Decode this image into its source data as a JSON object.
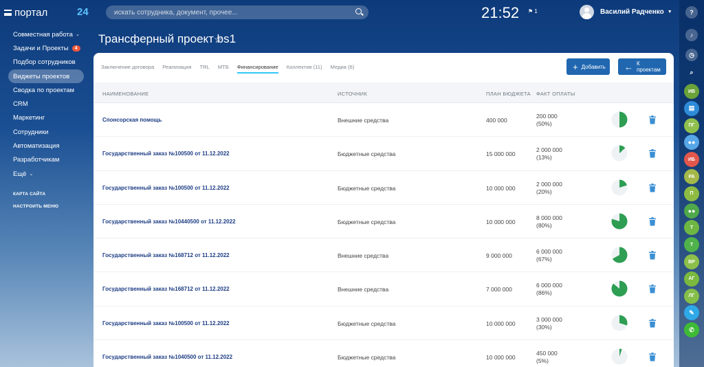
{
  "header": {
    "logo": "портал",
    "logo_suffix": "24",
    "search_placeholder": "искать сотрудника, документ, прочее...",
    "clock": "21:52",
    "flag_count": "1",
    "user_name": "Василий Радченко"
  },
  "sidebar": {
    "items": [
      {
        "label": "Совместная работа",
        "chevron": true
      },
      {
        "label": "Задачи и Проекты",
        "badge": "4"
      },
      {
        "label": "Подбор сотрудников"
      },
      {
        "label": "Виджеты проектов",
        "active": true
      },
      {
        "label": "Сводка по проектам"
      },
      {
        "label": "CRM"
      },
      {
        "label": "Маркетинг"
      },
      {
        "label": "Сотрудники"
      },
      {
        "label": "Автоматизация"
      },
      {
        "label": "Разработчикам"
      },
      {
        "label": "Ещё",
        "chevron": true
      }
    ],
    "site_map": "КАРТА САЙТА",
    "configure_menu": "НАСТРОИТЬ МЕНЮ"
  },
  "page": {
    "title": "Трансферный проект bs1"
  },
  "tabs": [
    {
      "label": "Заключение договора"
    },
    {
      "label": "Реализация"
    },
    {
      "label": "TRL"
    },
    {
      "label": "МТБ"
    },
    {
      "label": "Финансирование",
      "active": true
    },
    {
      "label": "Коллектив (11)"
    },
    {
      "label": "Медиа (6)"
    }
  ],
  "buttons": {
    "add": "Добавить",
    "to_projects": "К проектам"
  },
  "table": {
    "columns": [
      "НАИМЕНОВАНИЕ",
      "ИСТОЧНИК",
      "ПЛАН БЮДЖЕТА",
      "ФАКТ ОПЛАТЫ"
    ],
    "rows": [
      {
        "name": "Спонсорская помощь",
        "source": "Внешние средства",
        "plan": "400 000",
        "fact": "200 000",
        "percent_label": "(50%)",
        "percent": 50
      },
      {
        "name": "Государственный заказ №100500 от 11.12.2022",
        "source": "Бюджетные средства",
        "plan": "15 000 000",
        "fact": "2 000 000",
        "percent_label": "(13%)",
        "percent": 13
      },
      {
        "name": "Государственный заказ №100500 от 11.12.2022",
        "source": "Бюджетные средства",
        "plan": "10 000 000",
        "fact": "2 000 000",
        "percent_label": "(20%)",
        "percent": 20
      },
      {
        "name": "Государственный заказ №10440500 от 11.12.2022",
        "source": "Бюджетные средства",
        "plan": "10 000 000",
        "fact": "8 000 000",
        "percent_label": "(80%)",
        "percent": 80
      },
      {
        "name": "Государственный заказ №168712 от 11.12.2022",
        "source": "Внешние средства",
        "plan": "9 000 000",
        "fact": "6 000 000",
        "percent_label": "(67%)",
        "percent": 67
      },
      {
        "name": "Государственный заказ №168712 от 11.12.2022",
        "source": "Внешние средства",
        "plan": "7 000 000",
        "fact": "6 000 000",
        "percent_label": "(86%)",
        "percent": 86
      },
      {
        "name": "Государственный заказ №100500 от 11.12.2022",
        "source": "Бюджетные средства",
        "plan": "10 000 000",
        "fact": "3 000 000",
        "percent_label": "(30%)",
        "percent": 30
      },
      {
        "name": "Государственный заказ №1040500 от 11.12.2022",
        "source": "Бюджетные средства",
        "plan": "10 000 000",
        "fact": "450 000",
        "percent_label": "(5%)",
        "percent": 5
      }
    ]
  },
  "right_panel": {
    "avatars": [
      {
        "initials": "ИВ",
        "color": "#6aa33a"
      },
      {
        "initials": "",
        "color": "#2d8bd8",
        "icon": "chat-icon"
      },
      {
        "initials": "ПГ",
        "color": "#8fc04e"
      },
      {
        "initials": "",
        "color": "#57a6e8",
        "icon": "group-icon"
      },
      {
        "initials": "ИБ",
        "color": "#e2574c"
      },
      {
        "initials": "РА",
        "color": "#a4b84a"
      },
      {
        "initials": "П",
        "color": "#8ebc43"
      },
      {
        "initials": "",
        "color": "#4fa84a",
        "icon": "group-icon"
      },
      {
        "initials": "Т",
        "color": "#6fb743"
      },
      {
        "initials": "Т",
        "color": "#4fb24a"
      },
      {
        "initials": "ВР",
        "color": "#8cbf4a"
      },
      {
        "initials": "АГ",
        "color": "#7bb83f"
      },
      {
        "initials": "ЛГ",
        "color": "#86be4a"
      },
      {
        "initials": "",
        "color": "#2fa8e8",
        "icon": "new-chat-icon"
      },
      {
        "initials": "",
        "color": "#3fba36",
        "icon": "phone-icon"
      }
    ]
  },
  "colors": {
    "accent": "#2067b0",
    "tab_underline": "#2fc6f6",
    "pie_fill": "#2e9e53",
    "pie_bg": "#eef2f5",
    "delete_icon": "#3b8fd4",
    "badge": "#f0563a"
  }
}
